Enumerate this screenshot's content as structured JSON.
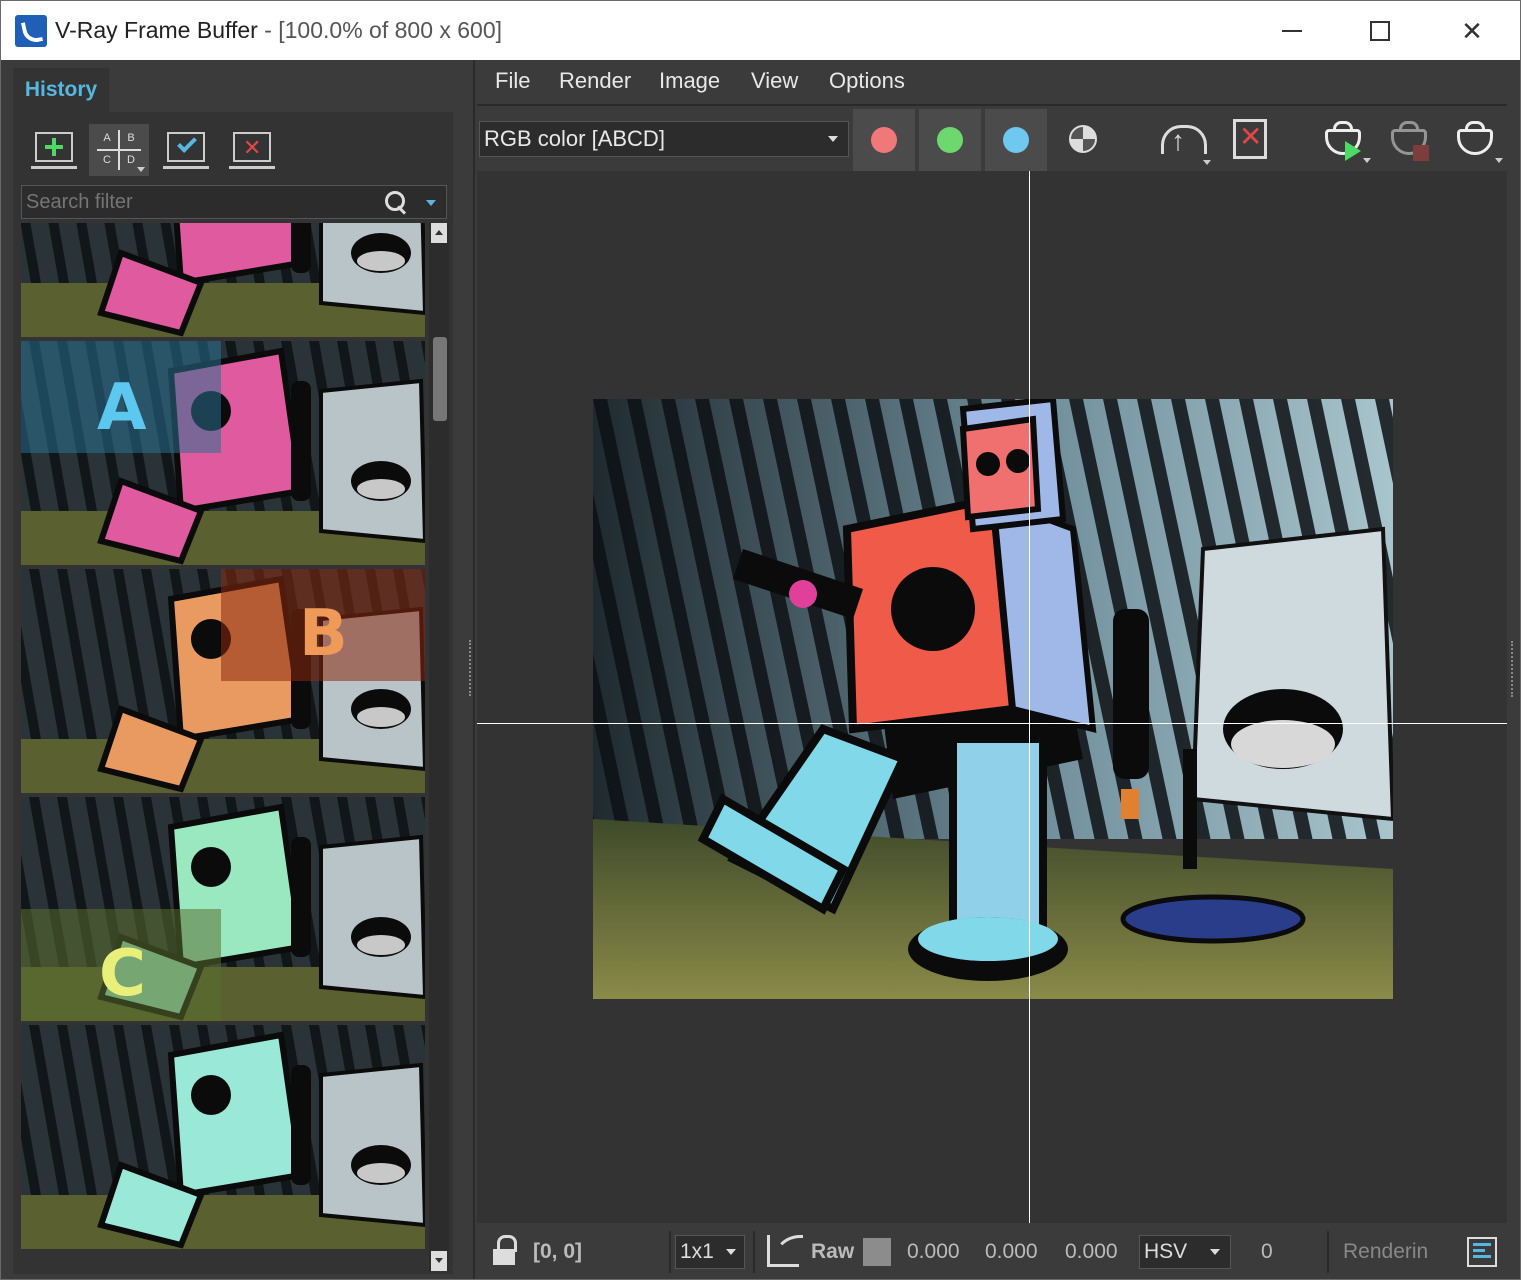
{
  "window": {
    "title": "V-Ray Frame Buffer",
    "title_suffix": " - [100.0% of 800 x 600]"
  },
  "history": {
    "tab_label": "History",
    "abcd": [
      "A",
      "B",
      "C",
      "D"
    ],
    "search_placeholder": "Search filter",
    "thumbnails": [
      {
        "label": ""
      },
      {
        "label": "A",
        "label_color": "#5cc8f0"
      },
      {
        "label": "B",
        "label_color": "#f09a5a"
      },
      {
        "label": "C",
        "label_color": "#e8f07a"
      },
      {
        "label": ""
      }
    ]
  },
  "menu": {
    "file": "File",
    "render": "Render",
    "image": "Image",
    "view": "View",
    "options": "Options"
  },
  "toolbar": {
    "channel": "RGB color [ABCD]",
    "channel_colors": {
      "red": "#f07878",
      "green": "#6ed86e",
      "blue": "#6ec8f0"
    }
  },
  "statusbar": {
    "coords": "[0, 0]",
    "zoom": "1x1",
    "raw_label": "Raw",
    "values": [
      "0.000",
      "0.000",
      "0.000"
    ],
    "color_space": "HSV",
    "hsv_value": "0",
    "status": "Renderin"
  },
  "colors": {
    "accent": "#56b8e0",
    "panel": "#333333",
    "window": "#3b3b3b"
  }
}
